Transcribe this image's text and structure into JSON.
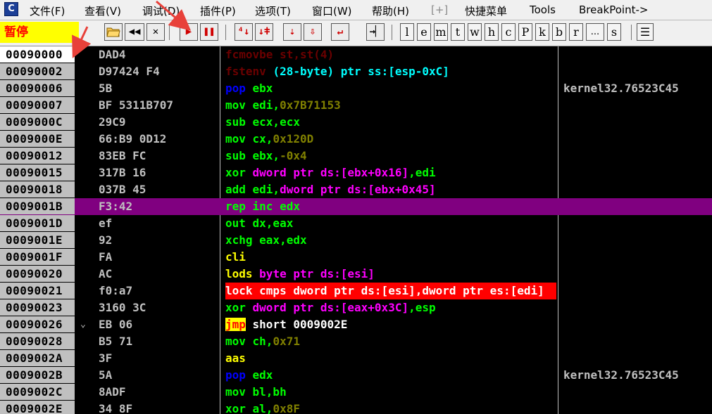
{
  "menu": {
    "items": [
      "文件(F)",
      "查看(V)",
      "调试(D)",
      "插件(P)",
      "选项(T)",
      "窗口(W)",
      "帮助(H)",
      "[+]",
      "快捷菜单",
      "Tools",
      "BreakPoint->"
    ],
    "app_icon_letter": "C"
  },
  "toolbar": {
    "status": "暂停",
    "buttons": {
      "open": "",
      "restart": "◀◀",
      "close": "✕",
      "run": "▶",
      "pause": "❚❚",
      "step_into": "⁴↓",
      "step_over": "↓ǂ",
      "trace_into": "⇣",
      "trace_over": "⇩",
      "execute_till_return": "↵",
      "goto": "→▏"
    },
    "letters": [
      "l",
      "e",
      "m",
      "t",
      "w",
      "h",
      "c",
      "P",
      "k",
      "b",
      "r",
      "...",
      "s"
    ],
    "last_icon": "☰"
  },
  "rows": [
    {
      "addr": "00090000",
      "jmp": "",
      "hex": "DAD4",
      "asm": [
        [
          "fcmovbe st,st(4)",
          "dim"
        ]
      ],
      "comment": ""
    },
    {
      "addr": "00090002",
      "jmp": "",
      "hex": "D97424 F4",
      "asm": [
        [
          "fstenv ",
          "dim"
        ],
        [
          "(28-byte) ptr ss:[esp-0xC]",
          "cyan"
        ]
      ],
      "comment": ""
    },
    {
      "addr": "00090006",
      "jmp": "",
      "hex": "5B",
      "asm": [
        [
          "pop ",
          "blue"
        ],
        [
          "ebx",
          "grn"
        ]
      ],
      "comment": "kernel32.76523C45"
    },
    {
      "addr": "00090007",
      "jmp": "",
      "hex": "BF 5311B707",
      "asm": [
        [
          "mov edi,",
          "grn"
        ],
        [
          "0x7B71153",
          "olive"
        ]
      ],
      "comment": ""
    },
    {
      "addr": "0009000C",
      "jmp": "",
      "hex": "29C9",
      "asm": [
        [
          "sub ecx,ecx",
          "grn"
        ]
      ],
      "comment": ""
    },
    {
      "addr": "0009000E",
      "jmp": "",
      "hex": "66:B9 0D12",
      "asm": [
        [
          "mov cx,",
          "grn"
        ],
        [
          "0x120D",
          "olive"
        ]
      ],
      "comment": ""
    },
    {
      "addr": "00090012",
      "jmp": "",
      "hex": "83EB FC",
      "asm": [
        [
          "sub ebx,",
          "grn"
        ],
        [
          "-0x4",
          "olive"
        ]
      ],
      "comment": ""
    },
    {
      "addr": "00090015",
      "jmp": "",
      "hex": "317B 16",
      "asm": [
        [
          "xor ",
          "grn"
        ],
        [
          "dword ptr ds:[ebx+0x16]",
          "mag"
        ],
        [
          ",edi",
          "grn"
        ]
      ],
      "comment": ""
    },
    {
      "addr": "00090018",
      "jmp": "",
      "hex": "037B 45",
      "asm": [
        [
          "add edi,",
          "grn"
        ],
        [
          "dword ptr ds:[ebx+0x45]",
          "mag"
        ]
      ],
      "comment": ""
    },
    {
      "addr": "0009001B",
      "jmp": "",
      "hex": "F3:42",
      "asm": [
        [
          "rep ",
          "grn"
        ],
        [
          "inc edx",
          "grn"
        ]
      ],
      "comment": "",
      "selected": true
    },
    {
      "addr": "0009001D",
      "jmp": "",
      "hex": "ef",
      "asm": [
        [
          "out dx,eax",
          "grn"
        ]
      ],
      "comment": ""
    },
    {
      "addr": "0009001E",
      "jmp": "",
      "hex": "92",
      "asm": [
        [
          "xchg eax,edx",
          "grn"
        ]
      ],
      "comment": ""
    },
    {
      "addr": "0009001F",
      "jmp": "",
      "hex": "FA",
      "asm": [
        [
          "cli",
          "yel"
        ]
      ],
      "comment": ""
    },
    {
      "addr": "00090020",
      "jmp": "",
      "hex": "AC",
      "asm": [
        [
          "lods ",
          "yel"
        ],
        [
          "byte ptr ds:[esi]",
          "mag"
        ]
      ],
      "comment": ""
    },
    {
      "addr": "00090021",
      "jmp": "",
      "hex": "f0:a7",
      "asm": [
        [
          "lock cmps dword ptr ds:[esi],dword ptr es:[edi]",
          "wht"
        ]
      ],
      "comment": "",
      "highlight": true
    },
    {
      "addr": "00090023",
      "jmp": "",
      "hex": "3160 3C",
      "asm": [
        [
          "xor ",
          "grn"
        ],
        [
          "dword ptr ds:[eax+0x3C]",
          "mag"
        ],
        [
          ",esp",
          "grn"
        ]
      ],
      "comment": ""
    },
    {
      "addr": "00090026",
      "jmp": "⌄",
      "hex": "EB 06",
      "asm": [
        [
          "jmp",
          "jmp"
        ],
        [
          " short 0009002E",
          "wht"
        ]
      ],
      "comment": ""
    },
    {
      "addr": "00090028",
      "jmp": "",
      "hex": "B5 71",
      "asm": [
        [
          "mov ch,",
          "grn"
        ],
        [
          "0x71",
          "olive"
        ]
      ],
      "comment": ""
    },
    {
      "addr": "0009002A",
      "jmp": "",
      "hex": "3F",
      "asm": [
        [
          "aas",
          "yel"
        ]
      ],
      "comment": ""
    },
    {
      "addr": "0009002B",
      "jmp": "",
      "hex": "5A",
      "asm": [
        [
          "pop ",
          "blue"
        ],
        [
          "edx",
          "grn"
        ]
      ],
      "comment": "kernel32.76523C45"
    },
    {
      "addr": "0009002C",
      "jmp": "",
      "hex": "8ADF",
      "asm": [
        [
          "mov bl,bh",
          "grn"
        ]
      ],
      "comment": ""
    },
    {
      "addr": "0009002E",
      "jmp": "",
      "hex": "34 8F",
      "asm": [
        [
          "xor al,",
          "grn"
        ],
        [
          "0x8F",
          "olive"
        ]
      ],
      "comment": ""
    }
  ],
  "colors": {
    "background": "#000000",
    "selected_row": "#800080",
    "highlight_row": "#ff0000",
    "status_bg": "#ffff00",
    "status_text": "#ff0000",
    "annotation_arrow": "#e8413a"
  }
}
